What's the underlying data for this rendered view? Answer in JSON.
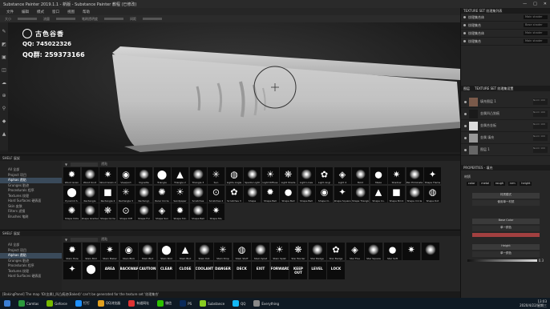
{
  "window": {
    "title": "Substance Painter 2019.1.1 - 新版 - Substance Painter 教程 (已修改)",
    "controls": [
      "—",
      "□",
      "✕"
    ]
  },
  "menu": [
    "文件",
    "编辑",
    "模式",
    "窗口",
    "视图",
    "帮助"
  ],
  "toolbar": {
    "size_label": "大小",
    "flow_label": "流量",
    "stroke_label": "笔刷透明度",
    "spacing_label": "间距"
  },
  "watermark": {
    "name": "古色谷香",
    "qq": "QQ: 745022326",
    "qq_group": "QQ群: 259373166"
  },
  "texture_set_list": {
    "header": "TEXTURE SET 纹理集列表",
    "rows": [
      {
        "name": "纹理集合体",
        "shader": "Main shader"
      },
      {
        "name": "纹理集合",
        "shader": "Base shader"
      },
      {
        "name": "纹理集合体",
        "shader": "Main shader"
      },
      {
        "name": "纹理集合",
        "shader": "Main shader"
      }
    ]
  },
  "layers": {
    "tabs": [
      "图层",
      "TEXTURE SET 纹理集设置"
    ],
    "rows": [
      {
        "name": "填充图层 1",
        "blend": "Norm 100"
      },
      {
        "name": "金属凹凸划痕",
        "blend": "Norm 100"
      },
      {
        "name": "金属合金板",
        "blend": "Norm 100"
      },
      {
        "name": "金属 填充",
        "blend": "Norm 100"
      },
      {
        "name": "图层 1",
        "blend": "Norm 100"
      }
    ]
  },
  "properties": {
    "header": "PROPERTIES - 填充",
    "section": "材质",
    "chips": [
      "color",
      "metal",
      "rough",
      "nrm",
      "height"
    ],
    "buttons": [
      "材质模式",
      "使用单一材质",
      "Base Color",
      "单一颜色",
      "Height",
      "单一颜色"
    ],
    "value": "0.3"
  },
  "shelf_top": {
    "header": "SHELF 展架",
    "categories": [
      "All 全部",
      "Project 项目",
      "Alphas 透贴",
      "Grunges 脏迹",
      "Procedurals 程序",
      "Textures 纹理",
      "Hard Surfaces 硬表面",
      "Skin 皮肤",
      "Filters 滤镜",
      "Brushes 笔刷"
    ],
    "selected": 2,
    "filter_label": "透贴",
    "tiles": [
      "Wood Grain",
      "Wood Knot",
      "Wood Grain 2",
      "Viewport",
      "Vignette",
      "Triangle",
      "Triangle 2",
      "Triangle 3",
      "Sun",
      "Lights Angle",
      "Sparks Light",
      "Light Diffuse",
      "Light Shade",
      "Light Lines",
      "Light Angl",
      "Light 4",
      "Mold",
      "Maze",
      "Shadow",
      "Pen Eliminate",
      "Shape Flame",
      "Pyramid S.",
      "Rectangle",
      "Rectangle 2",
      "Rectangle 3",
      "Rectangl.",
      "Ruler Circle",
      "Sandpaper",
      "Scratches",
      "Scratches 2",
      "Scratches 3",
      "Shape",
      "Shape Bell",
      "Shape Bell",
      "Shape Bell",
      "Shape Ci..",
      "Shape Square",
      "Shape Triangle",
      "Shape Co.",
      "Shape Brick",
      "Shape Circle",
      "Shape Dot",
      "Shape Dots",
      "Shape Gradient",
      "Shape Circle",
      "Shape Diff",
      "Shape Fur",
      "Shape Sun",
      "Shape Shr.",
      "Shape Bell",
      "Shape Mo."
    ]
  },
  "shelf_bottom": {
    "header": "SHELF 展架",
    "categories": [
      "All 全部",
      "Project 项目",
      "Alphas 透贴",
      "Grunges 脏迹",
      "Procedurals 程序",
      "Textures 纹理",
      "Hard Surfaces 硬表面"
    ],
    "selected": 2,
    "filter_label": "透贴",
    "tiles": [
      "Stain Hole",
      "Stain Blot",
      "Stain Maker",
      "Stain Blob",
      "Stain Blot",
      "Stain Blot",
      "Stain Blot",
      "Stain Dot",
      "Stain Drop",
      "Stain Stuff",
      "Stain Splat",
      "Stain Splat",
      "Star Border",
      "Star Badge",
      "Star Badge",
      "Star Five",
      "Star Square",
      "Star Soft",
      "",
      "",
      "",
      "",
      "AREA",
      "BACKWARD",
      "CAUTION",
      "CLEAR",
      "CLOSE",
      "COOLANT",
      "DANGER",
      "DECK",
      "EXIT",
      "FORWARD",
      "KEEP OUT",
      "LEVEL",
      "LOCK"
    ]
  },
  "status": "[BakingPanel] The map 'ID(金属)_凹凸痕迹(Baked)' can't be generated for the texture set '纹理集合'",
  "taskbar": {
    "apps": [
      "Camtas",
      "Geforce",
      "钉钉",
      "QQ浏览器",
      "有道网址",
      "微信",
      "PS",
      "Substance",
      "QQ",
      "Everything"
    ],
    "time": "13:03",
    "date": "2020/4/22/星期三"
  },
  "colors": {
    "accent": "#4a8fd6",
    "base_color": "#a24040",
    "height_color": "#cccccc"
  },
  "tool_icons": [
    "paint-brush-icon",
    "eraser-icon",
    "projection-icon",
    "geometry-mask-icon",
    "smudge-icon",
    "clone-icon",
    "color-picker-icon",
    "fill-icon",
    "polygon-fill-icon"
  ]
}
